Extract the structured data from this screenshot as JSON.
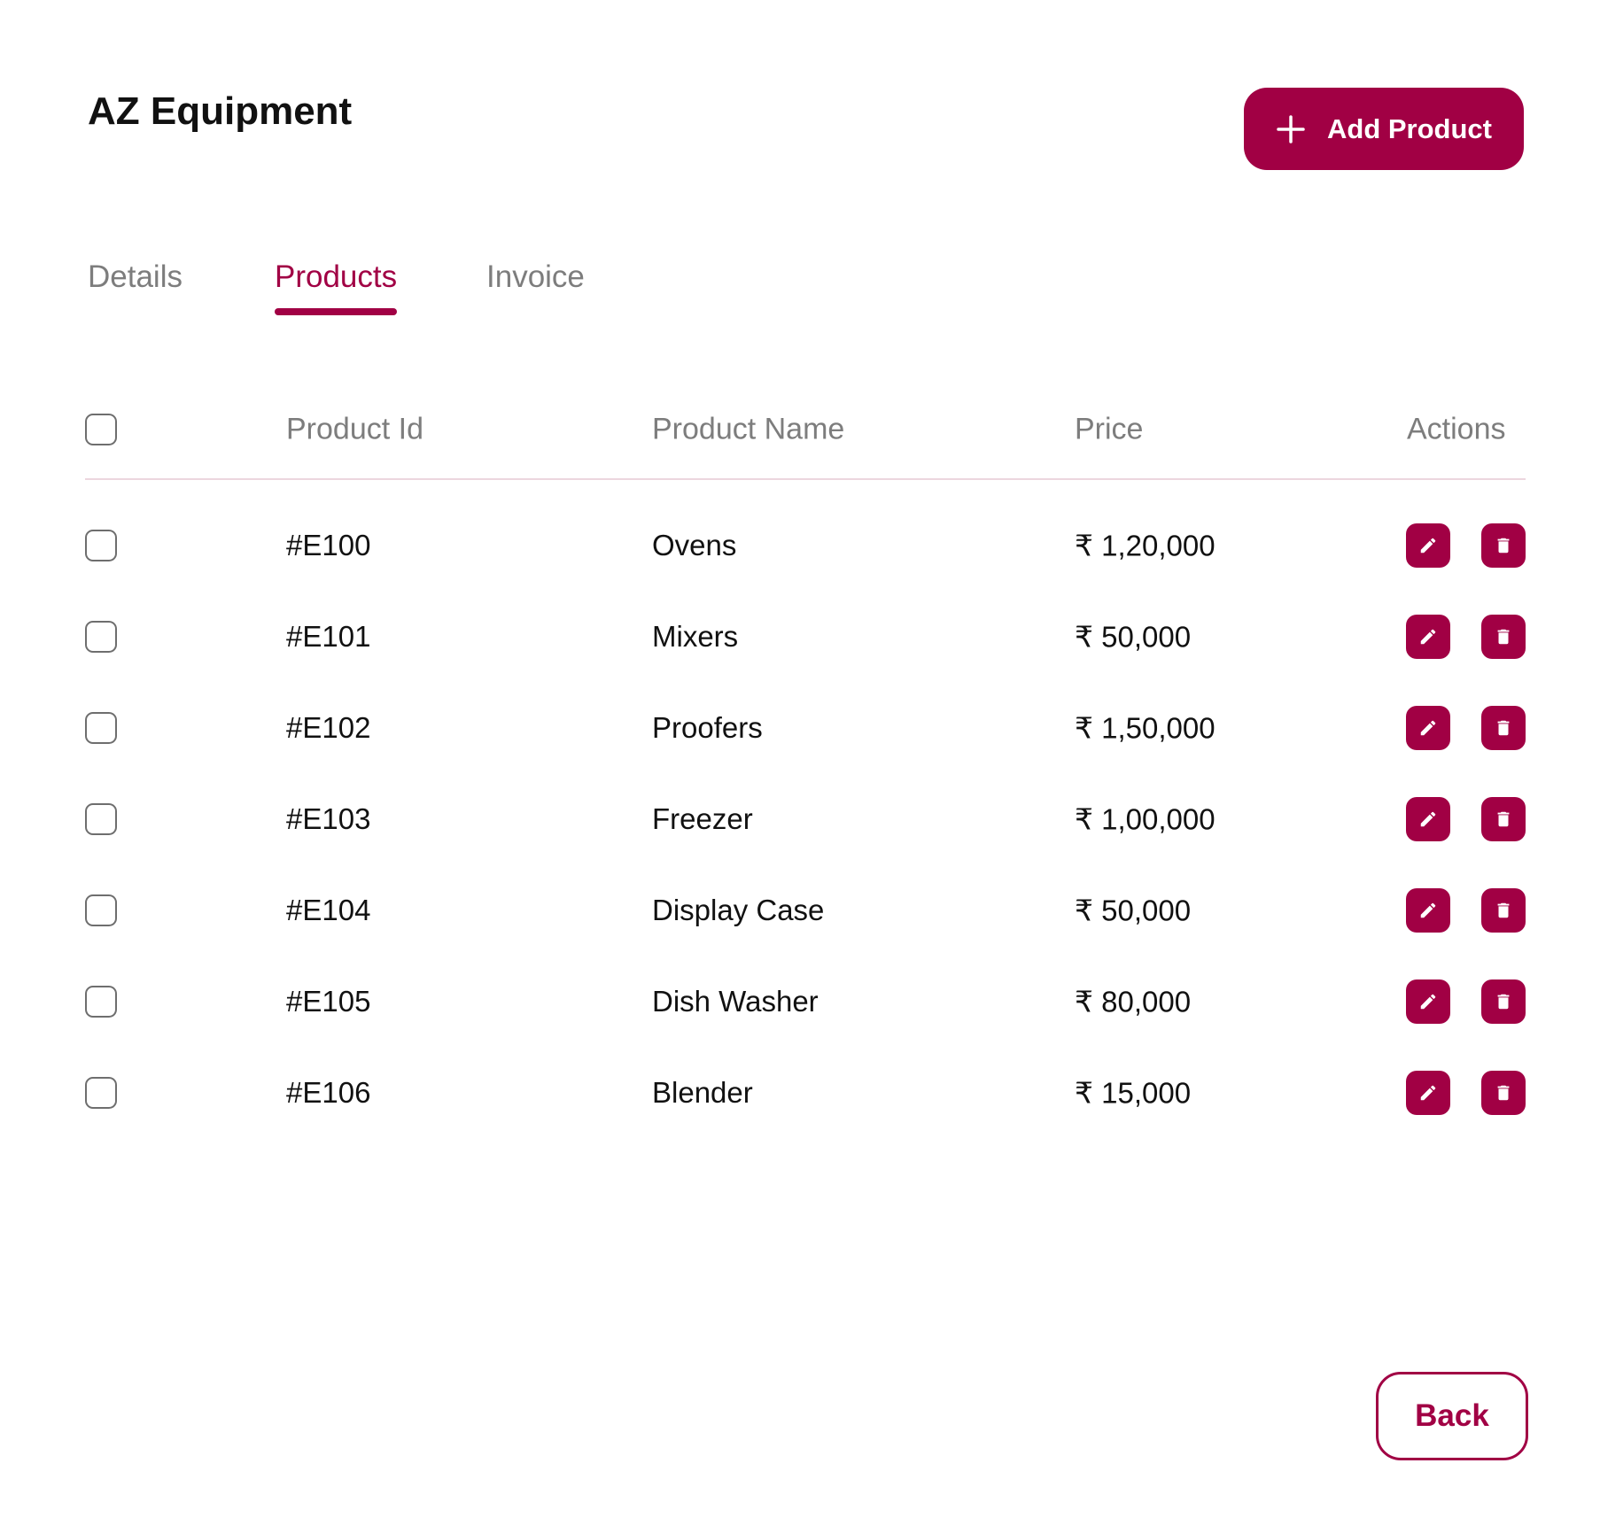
{
  "header": {
    "title": "AZ Equipment",
    "add_button_label": "Add Product"
  },
  "tabs": [
    {
      "label": "Details",
      "active": false
    },
    {
      "label": "Products",
      "active": true
    },
    {
      "label": "Invoice",
      "active": false
    }
  ],
  "table": {
    "columns": {
      "id": "Product Id",
      "name": "Product Name",
      "price": "Price",
      "actions": "Actions"
    },
    "rows": [
      {
        "id": "#E100",
        "name": "Ovens",
        "price": "₹ 1,20,000"
      },
      {
        "id": "#E101",
        "name": "Mixers",
        "price": "₹ 50,000"
      },
      {
        "id": "#E102",
        "name": "Proofers",
        "price": "₹ 1,50,000"
      },
      {
        "id": "#E103",
        "name": "Freezer",
        "price": "₹ 1,00,000"
      },
      {
        "id": "#E104",
        "name": "Display Case",
        "price": "₹ 50,000"
      },
      {
        "id": "#E105",
        "name": "Dish Washer",
        "price": "₹ 80,000"
      },
      {
        "id": "#E106",
        "name": "Blender",
        "price": "₹ 15,000"
      }
    ]
  },
  "footer": {
    "back_label": "Back"
  },
  "colors": {
    "accent": "#a10044",
    "muted_text": "#7d7d7d",
    "divider": "#ecd6de"
  },
  "icons": {
    "add": "plus-icon",
    "edit": "pencil-icon",
    "delete": "trash-icon"
  }
}
